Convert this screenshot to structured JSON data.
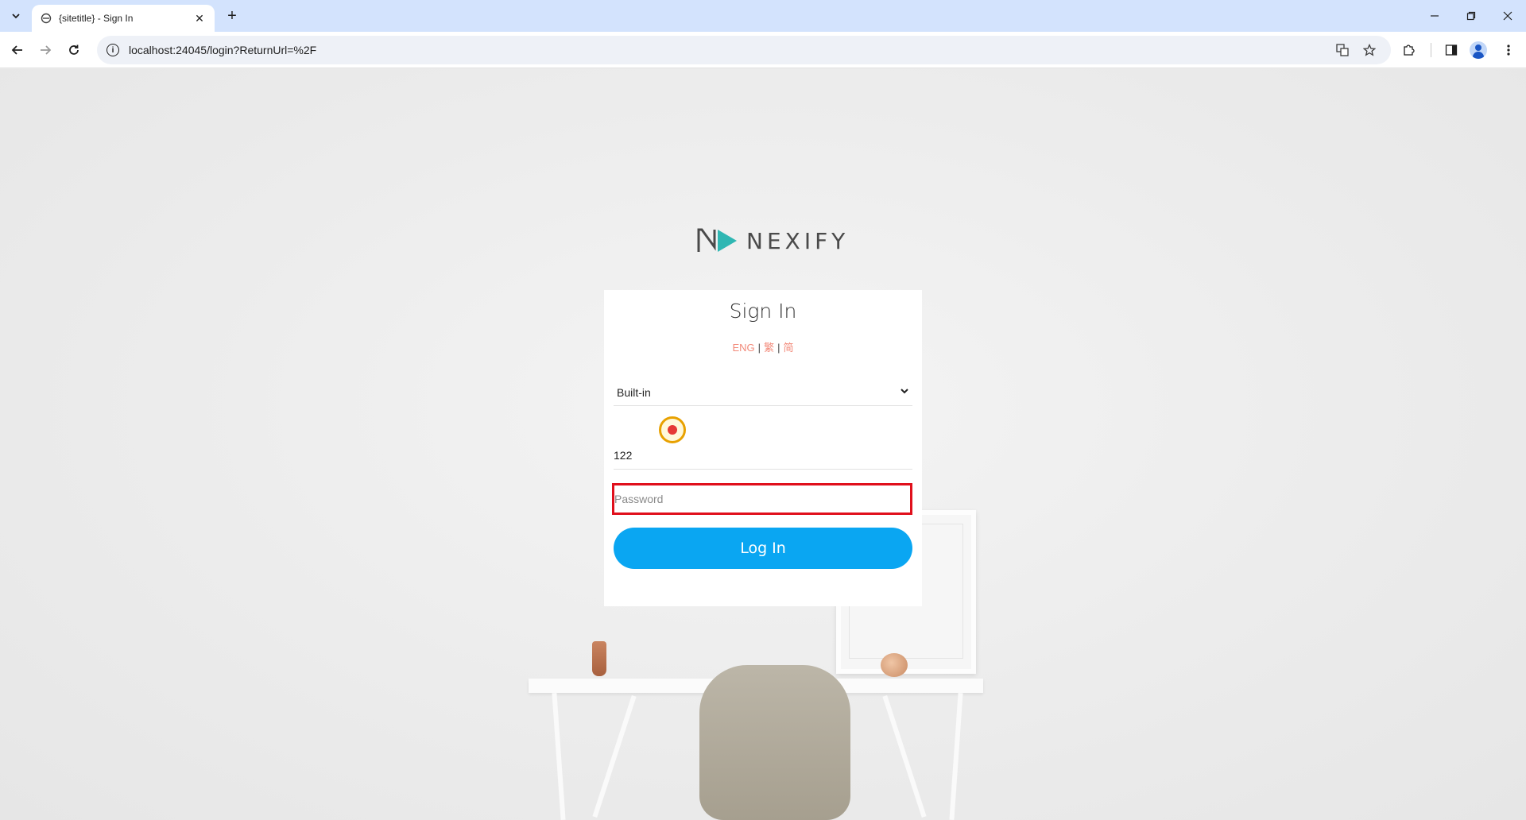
{
  "browser": {
    "tab_title": "{sitetitle} - Sign In",
    "url": "localhost:24045/login?ReturnUrl=%2F",
    "new_tab_symbol": "+",
    "icons": {
      "tab_dropdown": "chevron-down-icon",
      "favicon": "page-favicon-icon",
      "tab_close": "close-icon",
      "back": "back-arrow-icon",
      "forward": "forward-arrow-icon",
      "reload": "reload-icon",
      "site_info": "info-icon",
      "translate": "translate-icon",
      "bookmark": "star-icon",
      "extensions": "puzzle-icon",
      "side_panel": "side-panel-icon",
      "profile": "profile-icon",
      "menu": "kebab-menu-icon",
      "minimize": "minimize-icon",
      "restore": "restore-icon",
      "close_window": "close-icon"
    }
  },
  "page": {
    "logo_text": "NEXIFY",
    "logo_colors": {
      "n": "#4a4a4a",
      "triangle": "#2fb7b3"
    },
    "heading": "Sign In",
    "languages": [
      "ENG",
      "繁",
      "简"
    ],
    "language_separator": "|",
    "auth_method": "Built-in",
    "username_value": "122",
    "password_placeholder": "Password",
    "login_button": "Log In",
    "colors": {
      "accent": "#0aa6f2",
      "error_border": "#e0101c",
      "lang_link": "#f28a7a"
    }
  }
}
